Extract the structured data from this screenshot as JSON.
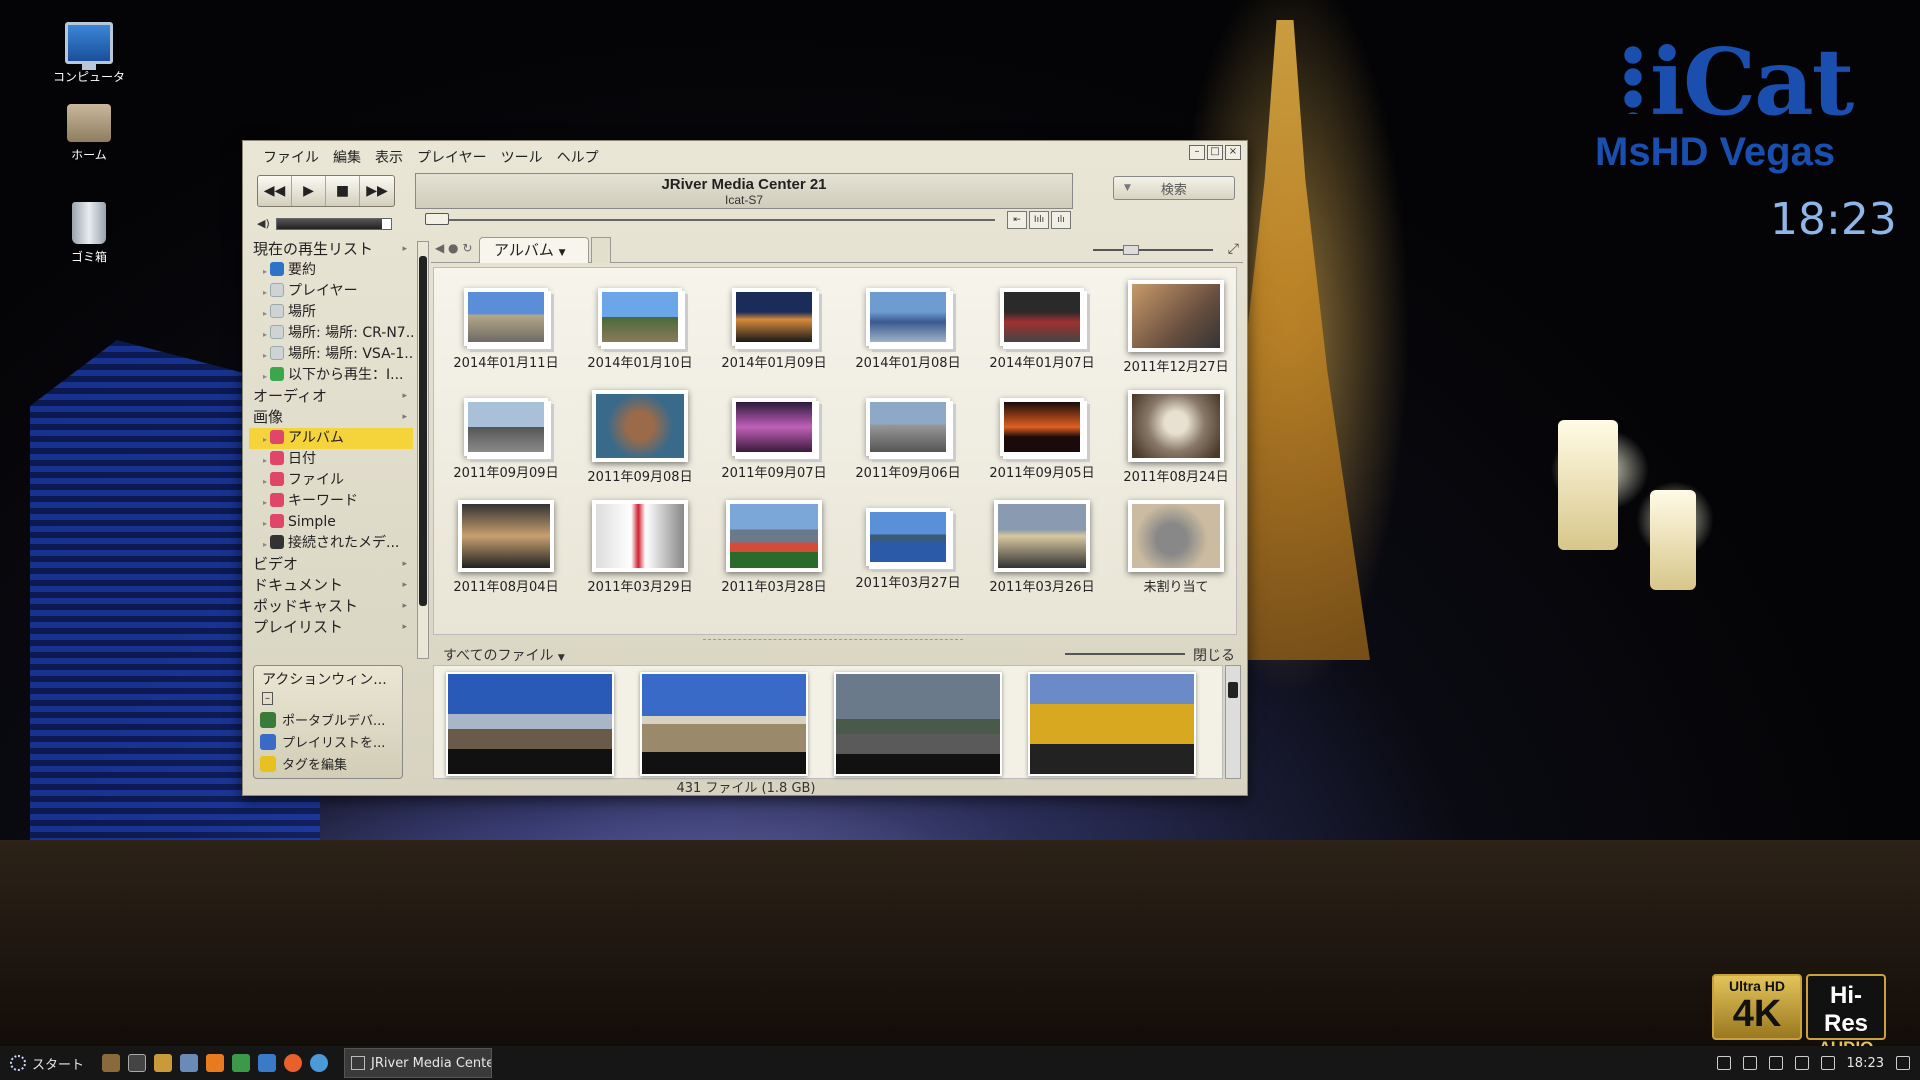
{
  "desktop": {
    "icons": [
      {
        "label": "コンピュータ"
      },
      {
        "label": "ホーム"
      },
      {
        "label": "ゴミ箱"
      }
    ]
  },
  "brand": {
    "logo": "iCat",
    "subtitle": "MsHD Vegas",
    "clock": "18:23",
    "badge_4k_top": "Ultra HD",
    "badge_4k_main": "4K",
    "badge_hr_top": "Hi-Res",
    "badge_hr_bottom": "AUDIO"
  },
  "window": {
    "menu": [
      "ファイル",
      "編集",
      "表示",
      "プレイヤー",
      "ツール",
      "ヘルプ"
    ],
    "display_title": "JRiver Media Center 21",
    "display_subtitle": "Icat-S7",
    "search_placeholder": "検索",
    "volume_level": 0.92,
    "seek_position": 0.0
  },
  "sidebar": {
    "sections": [
      {
        "label": "現在の再生リスト",
        "type": "cat"
      },
      {
        "label": "要約",
        "type": "sub",
        "icon": "summary-icon"
      },
      {
        "label": "プレイヤー",
        "type": "sub",
        "icon": "player-icon"
      },
      {
        "label": "場所",
        "type": "sub",
        "icon": "location-icon"
      },
      {
        "label": "場所: 場所: CR-N7...",
        "type": "sub",
        "icon": "location-icon"
      },
      {
        "label": "場所: 場所: VSA-1...",
        "type": "sub",
        "icon": "location-icon"
      },
      {
        "label": "以下から再生：I...",
        "type": "sub",
        "icon": "play-from-icon"
      },
      {
        "label": "オーディオ",
        "type": "cat"
      },
      {
        "label": "画像",
        "type": "cat"
      },
      {
        "label": "アルバム",
        "type": "sub",
        "icon": "camera-icon",
        "selected": true
      },
      {
        "label": "日付",
        "type": "sub",
        "icon": "camera-icon"
      },
      {
        "label": "ファイル",
        "type": "sub",
        "icon": "camera-icon"
      },
      {
        "label": "キーワード",
        "type": "sub",
        "icon": "camera-icon"
      },
      {
        "label": "Simple",
        "type": "sub",
        "icon": "camera-icon"
      },
      {
        "label": "接続されたメデ...",
        "type": "sub",
        "icon": "device-icon"
      },
      {
        "label": "ビデオ",
        "type": "cat"
      },
      {
        "label": "ドキュメント",
        "type": "cat"
      },
      {
        "label": "ポッドキャスト",
        "type": "cat"
      },
      {
        "label": "プレイリスト",
        "type": "cat"
      }
    ]
  },
  "actions": {
    "title": "アクションウィン...",
    "items": [
      "ポータブルデバ...",
      "プレイリストを...",
      "タグを編集"
    ]
  },
  "tab": {
    "label": "アルバム"
  },
  "albums": [
    {
      "caption": "2014年01月11日",
      "photo": "p-desert",
      "stack": true
    },
    {
      "caption": "2014年01月10日",
      "photo": "p-palms",
      "stack": true
    },
    {
      "caption": "2014年01月09日",
      "photo": "p-night",
      "stack": true
    },
    {
      "caption": "2014年01月08日",
      "photo": "p-city",
      "stack": true
    },
    {
      "caption": "2014年01月07日",
      "photo": "p-cars",
      "stack": true
    },
    {
      "caption": "2011年12月27日",
      "photo": "p-dino",
      "stack": false
    },
    {
      "caption": "2011年09月09日",
      "photo": "p-heli",
      "stack": true
    },
    {
      "caption": "2011年09月08日",
      "photo": "p-turtle",
      "stack": false
    },
    {
      "caption": "2011年09月07日",
      "photo": "p-pink",
      "stack": true
    },
    {
      "caption": "2011年09月06日",
      "photo": "p-road",
      "stack": true
    },
    {
      "caption": "2011年09月05日",
      "photo": "p-sunset",
      "stack": true
    },
    {
      "caption": "2011年08月24日",
      "photo": "p-cat",
      "stack": false
    },
    {
      "caption": "2011年08月04日",
      "photo": "p-car2",
      "stack": false
    },
    {
      "caption": "2011年03月29日",
      "photo": "p-train",
      "stack": false
    },
    {
      "caption": "2011年03月28日",
      "photo": "p-fuji",
      "stack": false
    },
    {
      "caption": "2011年03月27日",
      "photo": "p-island",
      "stack": true
    },
    {
      "caption": "2011年03月26日",
      "photo": "p-volc",
      "stack": false
    },
    {
      "caption": "未割り当て",
      "photo": "p-kitten",
      "stack": false
    }
  ],
  "lower": {
    "label": "すべてのファイル",
    "close": "閉じる",
    "photos": [
      "s1",
      "s2",
      "s3",
      "s4"
    ]
  },
  "status": "431 ファイル (1.8 GB)",
  "taskbar": {
    "start": "スタート",
    "task": "JRiver Media Cente...",
    "clock": "18:23"
  }
}
